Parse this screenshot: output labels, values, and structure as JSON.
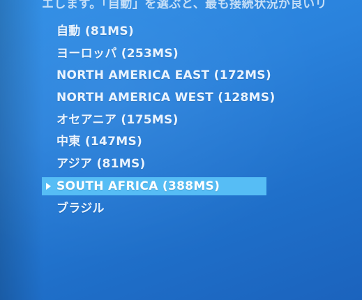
{
  "header": {
    "instruction_text": "エします。「自動」を選ぶと、最も接続状況が良いリ"
  },
  "regions": [
    {
      "label": "自動 (81MS)"
    },
    {
      "label": "ヨーロッパ (253MS)"
    },
    {
      "label": "NORTH AMERICA EAST (172MS)"
    },
    {
      "label": "NORTH AMERICA WEST (128MS)"
    },
    {
      "label": "オセアニア (175MS)"
    },
    {
      "label": "中東 (147MS)"
    },
    {
      "label": "アジア (81MS)"
    },
    {
      "label": "SOUTH AFRICA (388MS)"
    },
    {
      "label": "ブラジル"
    }
  ],
  "selected_region": "SOUTH AFRICA (388MS)",
  "colors": {
    "background": "#2a82dc",
    "selection_highlight": "#56bdf5",
    "text": "#eaf4ff"
  },
  "icons": {
    "selection_marker": "triangle-right-icon"
  }
}
